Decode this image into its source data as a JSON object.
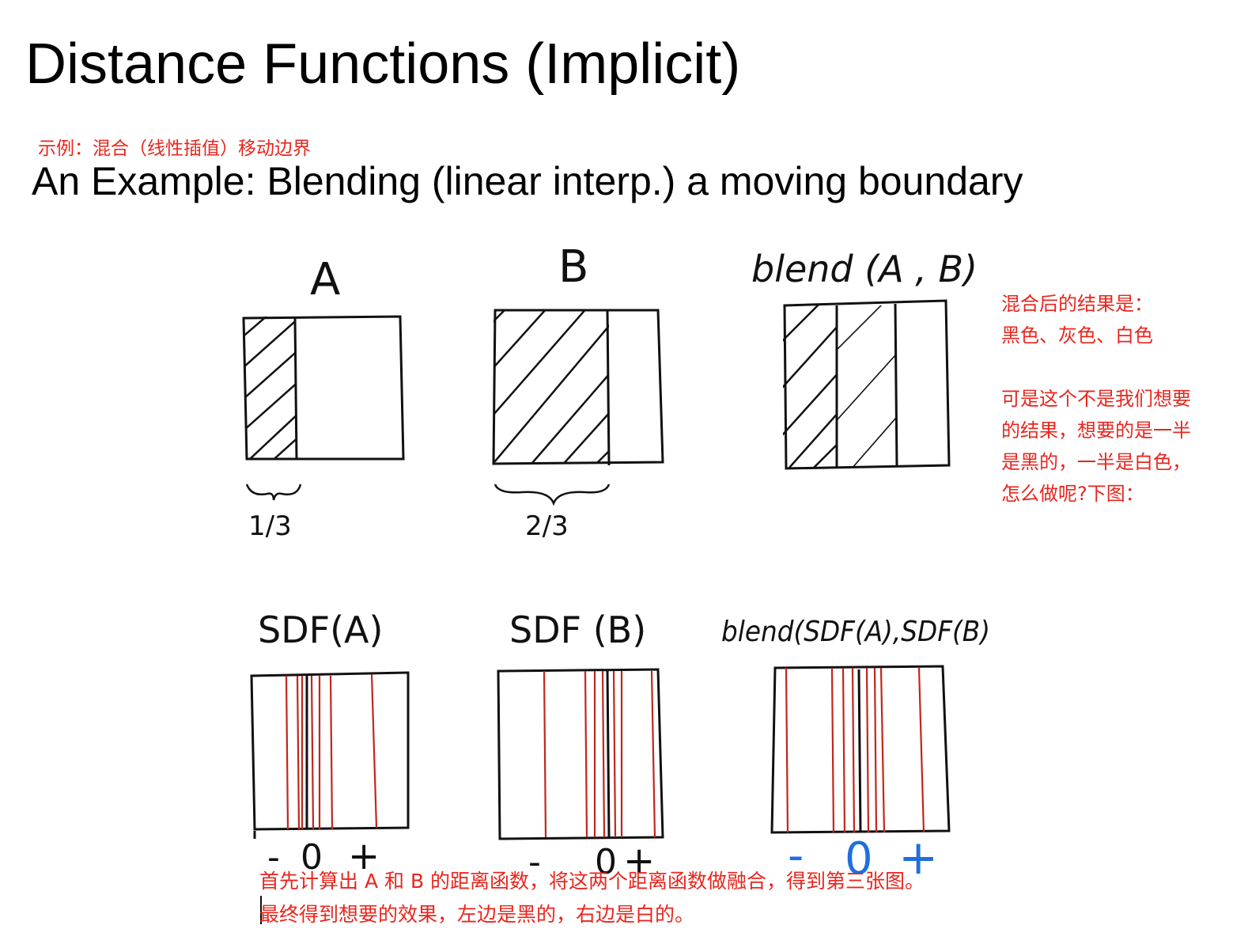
{
  "slide": {
    "title": "Distance Functions (Implicit)",
    "note_cn": "示例：混合（线性插值）移动边界",
    "subtitle": "An Example: Blending (linear interp.) a moving boundary"
  },
  "top_row": {
    "a_label": "A",
    "b_label": "B",
    "blend_label": "blend (A , B)",
    "a_fraction": "1/3",
    "b_fraction": "2/3"
  },
  "bottom_row": {
    "sdf_a_label": "SDF(A)",
    "sdf_b_label": "SDF (B)",
    "blend_sdf_label": "blend(SDF(A),SDF(B)",
    "axis_a": {
      "minus": "-",
      "zero": "0",
      "plus": "+"
    },
    "axis_b": {
      "minus": "-",
      "zero": "0",
      "plus": "+"
    },
    "axis_blend": {
      "minus": "-",
      "zero": "0",
      "plus": "+"
    }
  },
  "side_note": {
    "line1": "混合后的结果是：",
    "line2": "黑色、灰色、白色",
    "line3": "可是这个不是我们想要",
    "line4": "的结果，想要的是一半",
    "line5": "是黑的，一半是白色，",
    "line6": "怎么做呢?下图："
  },
  "bottom_note": {
    "line1": "首先计算出 A 和 B 的距离函数，将这两个距离函数做融合，得到第三张图。",
    "line2": "最终得到想要的效果，左边是黑的，右边是白的。"
  },
  "colors": {
    "annotation": "#e8261e",
    "sketch": "#111111",
    "contour": "#c0271e",
    "axis_blue": "#1f6fe0"
  }
}
